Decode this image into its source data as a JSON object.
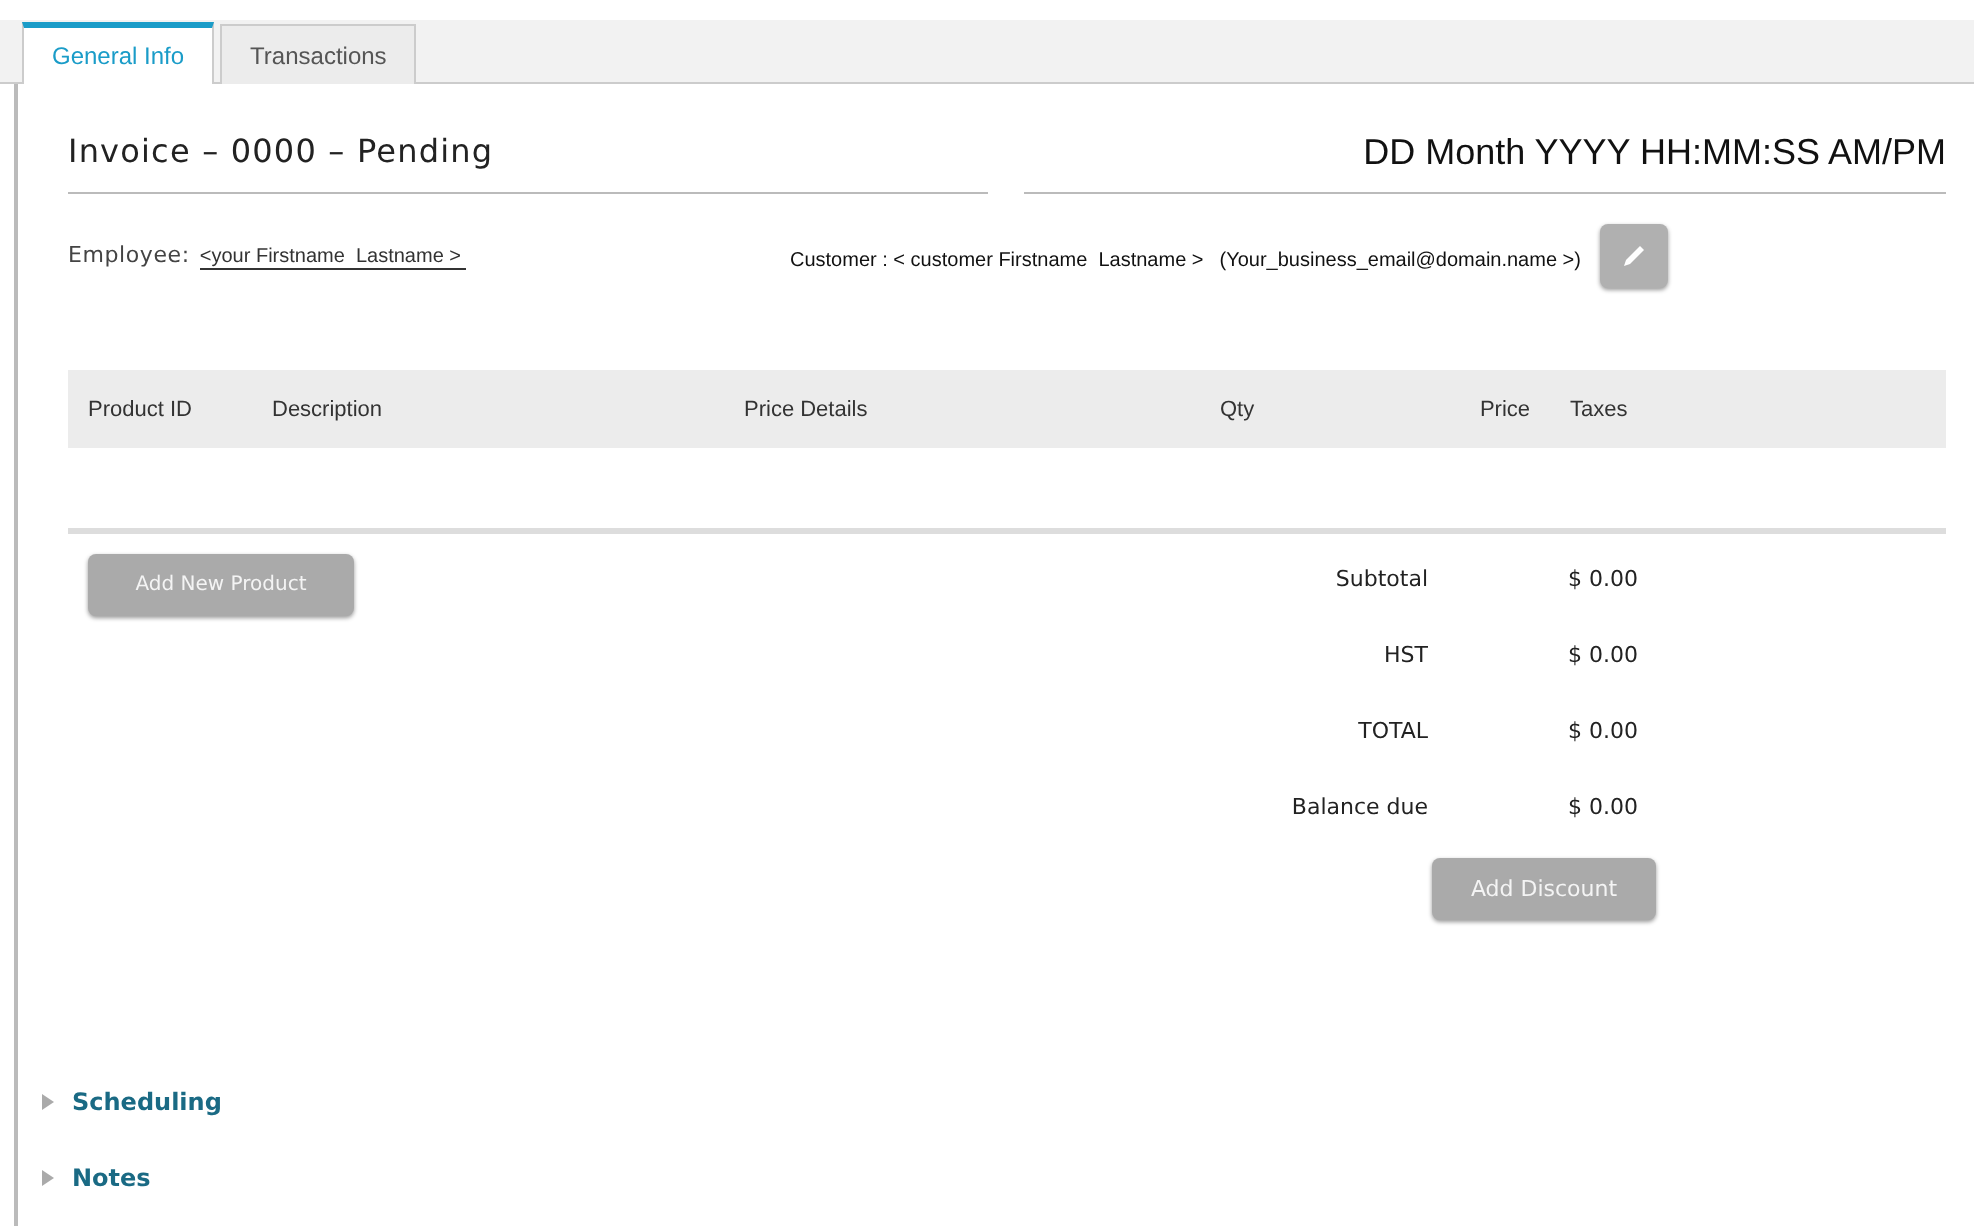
{
  "tabs": [
    {
      "label": "General Info",
      "selected": true
    },
    {
      "label": "Transactions",
      "selected": false
    }
  ],
  "invoice": {
    "title": "Invoice – 0000 – Pending",
    "datetime": "DD Month YYYY HH:MM:SS AM/PM"
  },
  "employee": {
    "label": "Employee:",
    "value": "<your Firstname  Lastname > "
  },
  "customer": {
    "text": "Customer : < customer Firstname  Lastname >",
    "email": "(Your_business_email@domain.name >)"
  },
  "table": {
    "columns": [
      "Product ID",
      "Description",
      "Price Details",
      "Qty",
      "Price",
      "Taxes"
    ]
  },
  "add_product_button": "Add New Product",
  "totals": [
    {
      "label": "Subtotal",
      "value": "$ 0.00"
    },
    {
      "label": "HST",
      "value": "$ 0.00"
    },
    {
      "label": "TOTAL",
      "value": "$ 0.00"
    },
    {
      "label": "Balance due",
      "value": "$ 0.00"
    }
  ],
  "add_discount_button": "Add Discount",
  "sections": [
    {
      "label": "Scheduling",
      "expanded": false
    },
    {
      "label": "Notes",
      "expanded": false
    }
  ]
}
